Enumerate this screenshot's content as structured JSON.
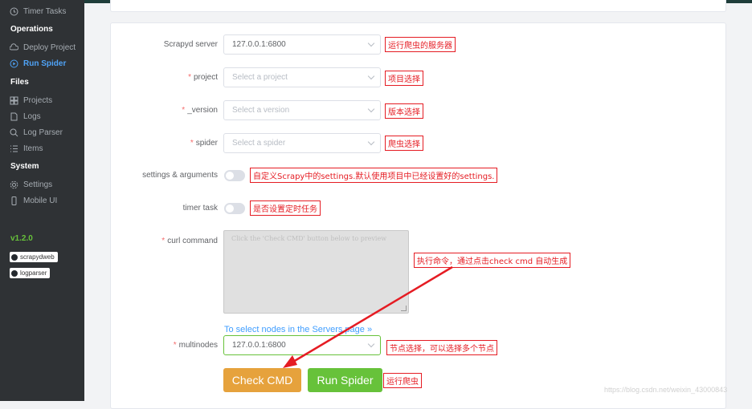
{
  "sidebar": {
    "timer_tasks": "Timer Tasks",
    "operations_head": "Operations",
    "deploy_project": "Deploy Project",
    "run_spider": "Run Spider",
    "files_head": "Files",
    "projects": "Projects",
    "logs": "Logs",
    "log_parser": "Log Parser",
    "items": "Items",
    "system_head": "System",
    "settings": "Settings",
    "mobile_ui": "Mobile UI",
    "version": "v1.2.0",
    "badge_scrapydweb": "scrapydweb",
    "badge_logparser": "logparser"
  },
  "form": {
    "scrapyd_server_label": "Scrapyd server",
    "scrapyd_server_value": "127.0.0.1:6800",
    "project_label": "project",
    "project_placeholder": "Select a project",
    "version_label": "_version",
    "version_placeholder": "Select a version",
    "spider_label": "spider",
    "spider_placeholder": "Select a spider",
    "settings_label": "settings & arguments",
    "timer_label": "timer task",
    "curl_label": "curl command",
    "curl_placeholder": "Click the 'Check CMD' button below to preview",
    "nodes_link": "To select nodes in the Servers page »",
    "multinodes_label": "multinodes",
    "multinodes_value": "127.0.0.1:6800",
    "required_mark": "*",
    "check_cmd": "Check CMD",
    "run_spider_btn": "Run Spider"
  },
  "annotations": {
    "server": "运行爬虫的服务器",
    "project": "项目选择",
    "version": "版本选择",
    "spider": "爬虫选择",
    "settings": "自定义Scrapy中的settings.默认使用项目中已经设置好的settings.",
    "timer": "是否设置定时任务",
    "cmd": "执行命令，通过点击check cmd 自动生成",
    "nodes": "节点选择，可以选择多个节点",
    "run": "运行爬虫"
  },
  "watermark": "https://blog.csdn.net/weixin_43000843",
  "colors": {
    "accent": "#409eff",
    "orange": "#e6a23c",
    "green": "#67c23a",
    "annotation_red": "#e51c23"
  }
}
